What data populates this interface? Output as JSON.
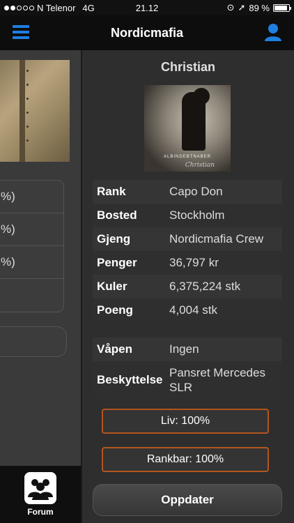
{
  "status_bar": {
    "carrier": "N Telenor",
    "network": "4G",
    "time": "21.12",
    "battery": "89 %",
    "battery_level": 0.89
  },
  "nav": {
    "title": "Nordicmafia"
  },
  "left_panel": {
    "list_items": [
      "%)",
      "%)",
      "%)",
      ""
    ],
    "tab_label": "Forum"
  },
  "profile": {
    "name": "Christian",
    "avatar_caption": "ALBINDEBTNABER",
    "avatar_signature": "Christian",
    "stats": [
      {
        "label": "Rank",
        "value": "Capo Don"
      },
      {
        "label": "Bosted",
        "value": "Stockholm"
      },
      {
        "label": "Gjeng",
        "value": "Nordicmafia Crew"
      },
      {
        "label": "Penger",
        "value": "36,797 kr"
      },
      {
        "label": "Kuler",
        "value": "6,375,224 stk"
      },
      {
        "label": "Poeng",
        "value": "4,004 stk"
      }
    ],
    "equipment": [
      {
        "label": "Våpen",
        "value": "Ingen"
      },
      {
        "label": "Beskyttelse",
        "value": "Pansret Mercedes SLR"
      }
    ],
    "health_label": "Liv: 100%",
    "rankbar_label": "Rankbar: 100%",
    "update_button": "Oppdater"
  },
  "colors": {
    "accent_blue": "#1e7fe0",
    "bar_border": "#b4551e"
  }
}
